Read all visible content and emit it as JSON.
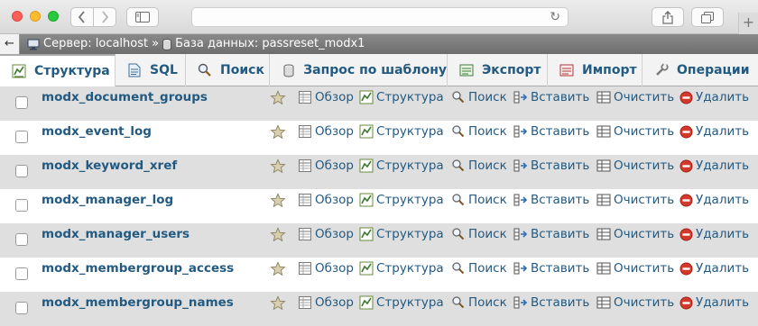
{
  "browser": {
    "url": "",
    "new_tab_label": "+"
  },
  "breadcrumb": {
    "server_label": "Сервер: localhost",
    "separator": "»",
    "database_label": "База данных: passreset_modx1",
    "back_symbol": "←"
  },
  "tabs": [
    {
      "label": "Структура",
      "icon": "structure-icon",
      "active": true
    },
    {
      "label": "SQL",
      "icon": "sql-icon",
      "active": false
    },
    {
      "label": "Поиск",
      "icon": "search-icon",
      "active": false
    },
    {
      "label": "Запрос по шаблону",
      "icon": "query-icon",
      "active": false
    },
    {
      "label": "Экспорт",
      "icon": "export-icon",
      "active": false
    },
    {
      "label": "Импорт",
      "icon": "import-icon",
      "active": false
    },
    {
      "label": "Операции",
      "icon": "operations-icon",
      "active": false
    }
  ],
  "actions": {
    "browse": "Обзор",
    "structure": "Структура",
    "search": "Поиск",
    "insert": "Вставить",
    "empty": "Очистить",
    "drop": "Удалить"
  },
  "tables": [
    {
      "name": "modx_document_groups"
    },
    {
      "name": "modx_event_log"
    },
    {
      "name": "modx_keyword_xref"
    },
    {
      "name": "modx_manager_log"
    },
    {
      "name": "modx_manager_users"
    },
    {
      "name": "modx_membergroup_access"
    },
    {
      "name": "modx_membergroup_names"
    }
  ],
  "colors": {
    "link": "#235a81",
    "row_odd": "#dfdfdf",
    "row_even": "#ffffff",
    "drop_red": "#d33a2c"
  }
}
